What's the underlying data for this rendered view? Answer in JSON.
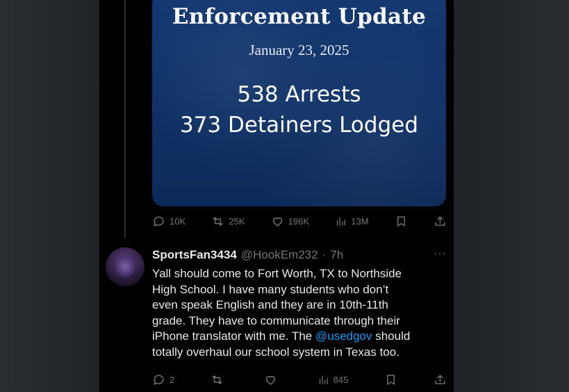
{
  "media": {
    "title": "Enforcement Update",
    "date": "January 23, 2025",
    "stat_arrests": "538 Arrests",
    "stat_detainers": "373 Detainers Lodged"
  },
  "post_actions": {
    "replies": "10K",
    "reposts": "25K",
    "likes": "196K",
    "views": "13M"
  },
  "reply": {
    "display_name": "SportsFan3434",
    "handle": "@HookEm232",
    "separator": "·",
    "time": "7h",
    "more": "···",
    "text_line1": "Yall should come to Fort Worth, TX to Northside",
    "text_line2": "High School. I have many students who don’t",
    "text_line3": "even speak English and they are in 10th-11th",
    "text_line4": "grade. They have to communicate through their",
    "text_line5_pre": "iPhone translator with me. The ",
    "mention": "@usedgov",
    "text_line5_post": " should",
    "text_line6": "totally overhaul our school system in Texas too.",
    "actions": {
      "replies": "2",
      "reposts": "",
      "likes": "",
      "views": "845"
    }
  },
  "colors": {
    "background": "#000000",
    "text_primary": "#e7e9ea",
    "text_secondary": "#71767b",
    "link": "#1d9bf0",
    "media_blue": "#0f3166"
  }
}
